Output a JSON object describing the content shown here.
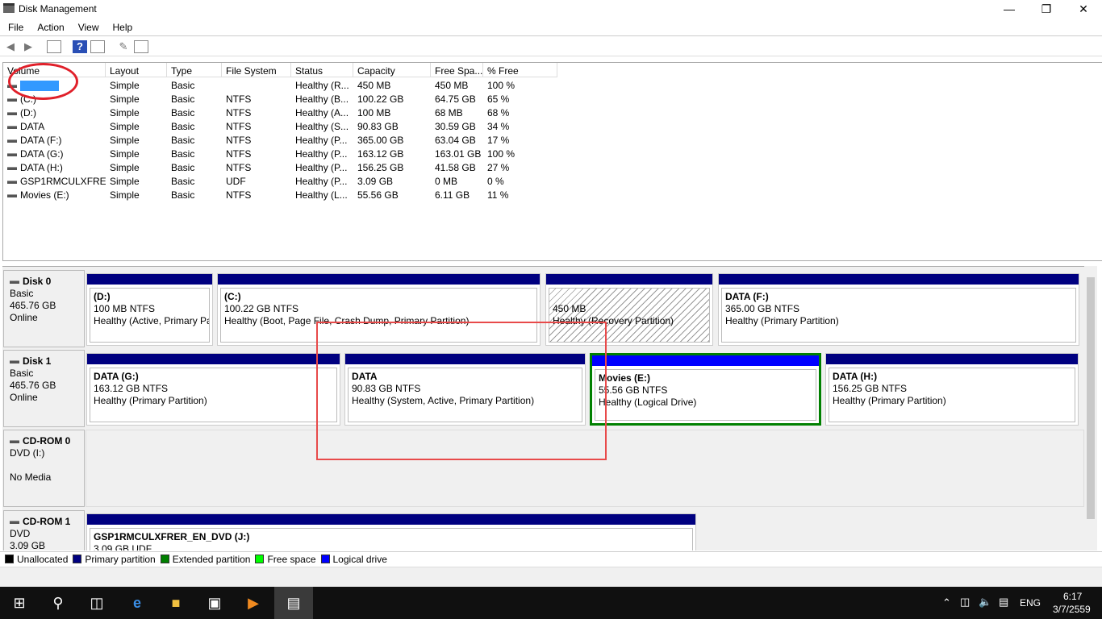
{
  "window": {
    "title": "Disk Management"
  },
  "menu": [
    "File",
    "Action",
    "View",
    "Help"
  ],
  "list": {
    "columns": [
      "Volume",
      "Layout",
      "Type",
      "File System",
      "Status",
      "Capacity",
      "Free Spa...",
      "% Free"
    ],
    "rows": [
      [
        "",
        "Simple",
        "Basic",
        "",
        "Healthy (R...",
        "450 MB",
        "450 MB",
        "100 %"
      ],
      [
        "(C:)",
        "Simple",
        "Basic",
        "NTFS",
        "Healthy (B...",
        "100.22 GB",
        "64.75 GB",
        "65 %"
      ],
      [
        "(D:)",
        "Simple",
        "Basic",
        "NTFS",
        "Healthy (A...",
        "100 MB",
        "68 MB",
        "68 %"
      ],
      [
        "DATA",
        "Simple",
        "Basic",
        "NTFS",
        "Healthy (S...",
        "90.83 GB",
        "30.59 GB",
        "34 %"
      ],
      [
        "DATA (F:)",
        "Simple",
        "Basic",
        "NTFS",
        "Healthy (P...",
        "365.00 GB",
        "63.04 GB",
        "17 %"
      ],
      [
        "DATA (G:)",
        "Simple",
        "Basic",
        "NTFS",
        "Healthy (P...",
        "163.12 GB",
        "163.01 GB",
        "100 %"
      ],
      [
        "DATA (H:)",
        "Simple",
        "Basic",
        "NTFS",
        "Healthy (P...",
        "156.25 GB",
        "41.58 GB",
        "27 %"
      ],
      [
        "GSP1RMCULXFRE...",
        "Simple",
        "Basic",
        "UDF",
        "Healthy (P...",
        "3.09 GB",
        "0 MB",
        "0 %"
      ],
      [
        "Movies (E:)",
        "Simple",
        "Basic",
        "NTFS",
        "Healthy (L...",
        "55.56 GB",
        "6.11 GB",
        "11 %"
      ]
    ]
  },
  "disks": [
    {
      "name": "Disk 0",
      "type": "Basic",
      "size": "465.76 GB",
      "state": "Online",
      "parts": [
        {
          "name": "(D:)",
          "size": "100 MB NTFS",
          "status": "Healthy (Active, Primary Partition)"
        },
        {
          "name": "(C:)",
          "size": "100.22 GB NTFS",
          "status": "Healthy (Boot, Page File, Crash Dump, Primary Partition)"
        },
        {
          "name": "",
          "size": "450 MB",
          "status": "Healthy (Recovery Partition)"
        },
        {
          "name": "DATA  (F:)",
          "size": "365.00 GB NTFS",
          "status": "Healthy (Primary Partition)"
        }
      ]
    },
    {
      "name": "Disk 1",
      "type": "Basic",
      "size": "465.76 GB",
      "state": "Online",
      "parts": [
        {
          "name": "DATA  (G:)",
          "size": "163.12 GB NTFS",
          "status": "Healthy (Primary Partition)"
        },
        {
          "name": "DATA",
          "size": "90.83 GB NTFS",
          "status": "Healthy (System, Active, Primary Partition)"
        },
        {
          "name": "Movies  (E:)",
          "size": "55.56 GB NTFS",
          "status": "Healthy (Logical Drive)"
        },
        {
          "name": "DATA  (H:)",
          "size": "156.25 GB NTFS",
          "status": "Healthy (Primary Partition)"
        }
      ]
    },
    {
      "name": "CD-ROM 0",
      "type": "DVD (I:)",
      "size": "",
      "state": "No Media",
      "parts": []
    },
    {
      "name": "CD-ROM 1",
      "type": "DVD",
      "size": "3.09 GB",
      "state": "",
      "parts": [
        {
          "name": "GSP1RMCULXFRER_EN_DVD  (J:)",
          "size": "3.09 GB UDF",
          "status": ""
        }
      ]
    }
  ],
  "legend": [
    {
      "label": "Unallocated",
      "color": "#000000"
    },
    {
      "label": "Primary partition",
      "color": "#000080"
    },
    {
      "label": "Extended partition",
      "color": "#008000"
    },
    {
      "label": "Free space",
      "color": "#00ff00"
    },
    {
      "label": "Logical drive",
      "color": "#0000ff"
    }
  ],
  "tray": {
    "lang": "ENG",
    "time": "6:17",
    "date": "3/7/2559"
  }
}
